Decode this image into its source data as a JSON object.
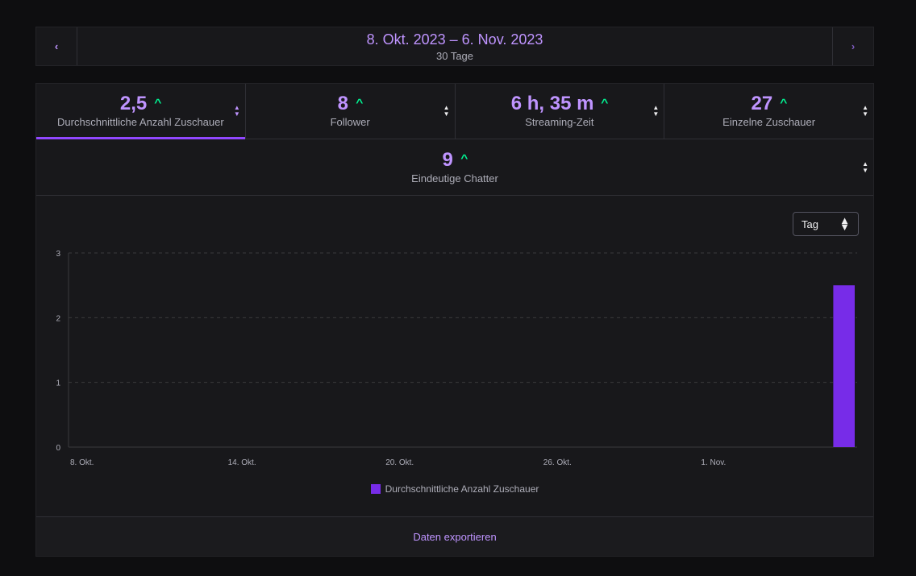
{
  "date_nav": {
    "prev_icon": "chevron-left-icon",
    "next_icon": "chevron-right-icon",
    "range": "8. Okt. 2023 – 6. Nov. 2023",
    "days": "30 Tage"
  },
  "metrics": [
    {
      "value": "2,5",
      "label": "Durchschnittliche Anzahl Zuschauer",
      "trend": "up",
      "active": true
    },
    {
      "value": "8",
      "label": "Follower",
      "trend": "up",
      "active": false
    },
    {
      "value": "6 h, 35 m",
      "label": "Streaming-Zeit",
      "trend": "up",
      "active": false
    },
    {
      "value": "27",
      "label": "Einzelne Zuschauer",
      "trend": "up",
      "active": false
    },
    {
      "value": "9",
      "label": "Eindeutige Chatter",
      "trend": "up",
      "active": false
    }
  ],
  "interval_select": {
    "value": "Tag"
  },
  "export_label": "Daten exportieren",
  "colors": {
    "accent": "#bf94ff",
    "bar": "#772ce8",
    "trend_up": "#00f593"
  },
  "chart_data": {
    "type": "bar",
    "title": "",
    "xlabel": "",
    "ylabel": "",
    "ylim": [
      0,
      3
    ],
    "yticks": [
      0,
      1,
      2,
      3
    ],
    "x_tick_labels": [
      "8. Okt.",
      "14. Okt.",
      "20. Okt.",
      "26. Okt.",
      "1. Nov."
    ],
    "x_tick_days": [
      0,
      6,
      12,
      18,
      24
    ],
    "num_days": 30,
    "grid": true,
    "legend": "bottom",
    "series": [
      {
        "name": "Durchschnittliche Anzahl Zuschauer",
        "points": [
          {
            "day": 29,
            "value": 2.5
          }
        ]
      }
    ]
  }
}
